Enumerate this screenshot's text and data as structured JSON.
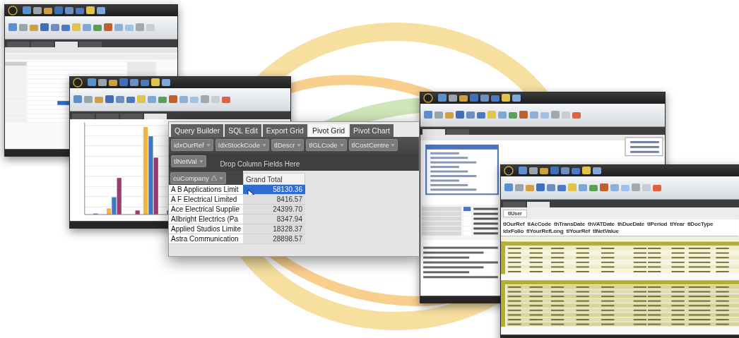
{
  "pivot_grid": {
    "tabs": [
      {
        "label": "Query Builder",
        "selected": false
      },
      {
        "label": "SQL Edit",
        "selected": false
      },
      {
        "label": "Export Grid",
        "selected": false
      },
      {
        "label": "Pivot Grid",
        "selected": true
      },
      {
        "label": "Pivot Chart",
        "selected": false
      }
    ],
    "filter_fields": [
      "idxOurRef",
      "IdxStockCode",
      "tlDescr",
      "tlGLCode",
      "tlCostCentre"
    ],
    "data_fields": [
      "tlNetVal"
    ],
    "column_area_hint": "Drop Column Fields Here",
    "row_fields": [
      "cuCompany"
    ],
    "column_header": "Grand Total",
    "rows": [
      {
        "label": "A B Applications Limit",
        "value": "58130.36",
        "selected": true
      },
      {
        "label": "A F Electrical Limited",
        "value": "8416.57",
        "selected": false
      },
      {
        "label": "Ace Electrical Supplie",
        "value": "24399.70",
        "selected": false
      },
      {
        "label": "Allbright Electrics (Pa",
        "value": "8347.94",
        "selected": false
      },
      {
        "label": "Applied Studios Limite",
        "value": "18328.37",
        "selected": false
      },
      {
        "label": "Astra Communication",
        "value": "28898.57",
        "selected": false
      }
    ]
  },
  "report_window": {
    "group_field": "tlUser",
    "columns": [
      "tlOurRef",
      "tlAcCode",
      "thTransDate",
      "thVATDate",
      "thDueDate",
      "tlPeriod",
      "tlYear",
      "tlDocType",
      "idxFolio",
      "tlYourRefLong",
      "tlYourRef",
      "tlNetValue"
    ]
  }
}
